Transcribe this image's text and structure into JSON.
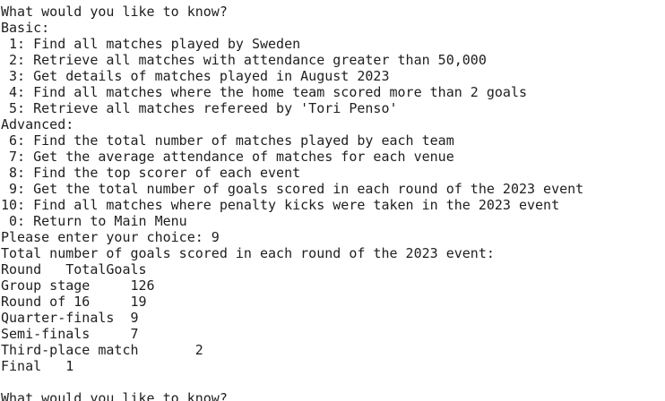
{
  "terminal": {
    "prompt_title": "What would you like to know?",
    "basic_header": "Basic:",
    "basic_items": [
      " 1: Find all matches played by Sweden",
      " 2: Retrieve all matches with attendance greater than 50,000",
      " 3: Get details of matches played in August 2023",
      " 4: Find all matches where the home team scored more than 2 goals",
      " 5: Retrieve all matches refereed by 'Tori Penso'"
    ],
    "advanced_header": "Advanced:",
    "advanced_items": [
      " 6: Find the total number of matches played by each team",
      " 7: Get the average attendance of matches for each venue",
      " 8: Find the top scorer of each event",
      " 9: Get the total number of goals scored in each round of the 2023 event",
      "10: Find all matches where penalty kicks were taken in the 2023 event",
      " 0: Return to Main Menu"
    ],
    "choice_line": "Please enter your choice: 9",
    "result_title": "Total number of goals scored in each round of the 2023 event:",
    "table_header": "Round   TotalGoals",
    "table_rows": [
      "Group stage     126",
      "Round of 16     19",
      "Quarter-finals  9",
      "Semi-finals     7",
      "Third-place match       2",
      "Final   1"
    ],
    "blank_line": "",
    "next_prompt": "What would you like to know?"
  }
}
